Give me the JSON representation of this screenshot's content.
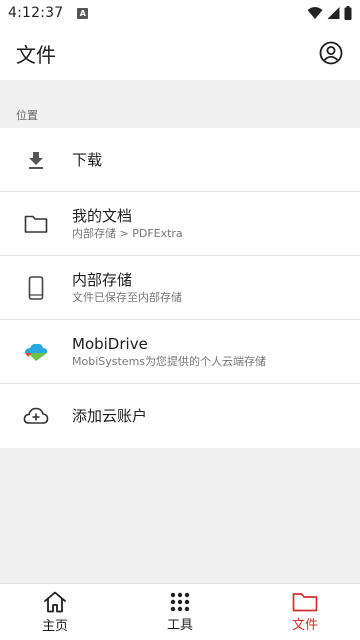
{
  "status_bar": {
    "time": "4:12:37",
    "notification_badge": "A",
    "icons": [
      "wifi-icon",
      "signal-icon",
      "battery-icon"
    ]
  },
  "app_bar": {
    "title": "文件",
    "profile_icon": "account-circle-icon"
  },
  "section": {
    "label": "位置"
  },
  "items": [
    {
      "icon": "download-icon",
      "title": "下载",
      "subtitle": ""
    },
    {
      "icon": "folder-icon",
      "title": "我的文档",
      "subtitle": "内部存储 > PDFExtra"
    },
    {
      "icon": "phone-icon",
      "title": "内部存储",
      "subtitle": "文件已保存至内部存储"
    },
    {
      "icon": "mobidrive-cloud-icon",
      "title": "MobiDrive",
      "subtitle": "MobiSystems为您提供的个人云端存储"
    },
    {
      "icon": "add-cloud-icon",
      "title": "添加云账户",
      "subtitle": ""
    }
  ],
  "bottom_nav": {
    "items": [
      {
        "icon": "home-icon",
        "label": "主页",
        "active": false
      },
      {
        "icon": "grid-icon",
        "label": "工具",
        "active": false
      },
      {
        "icon": "folder-icon",
        "label": "文件",
        "active": true
      }
    ]
  },
  "colors": {
    "accent": "#d32f2f",
    "background": "#f0f0f0",
    "surface": "#ffffff",
    "mobidrive_blue": "#29a8e0",
    "mobidrive_green": "#6cc24a",
    "mobidrive_red": "#e8453c"
  }
}
